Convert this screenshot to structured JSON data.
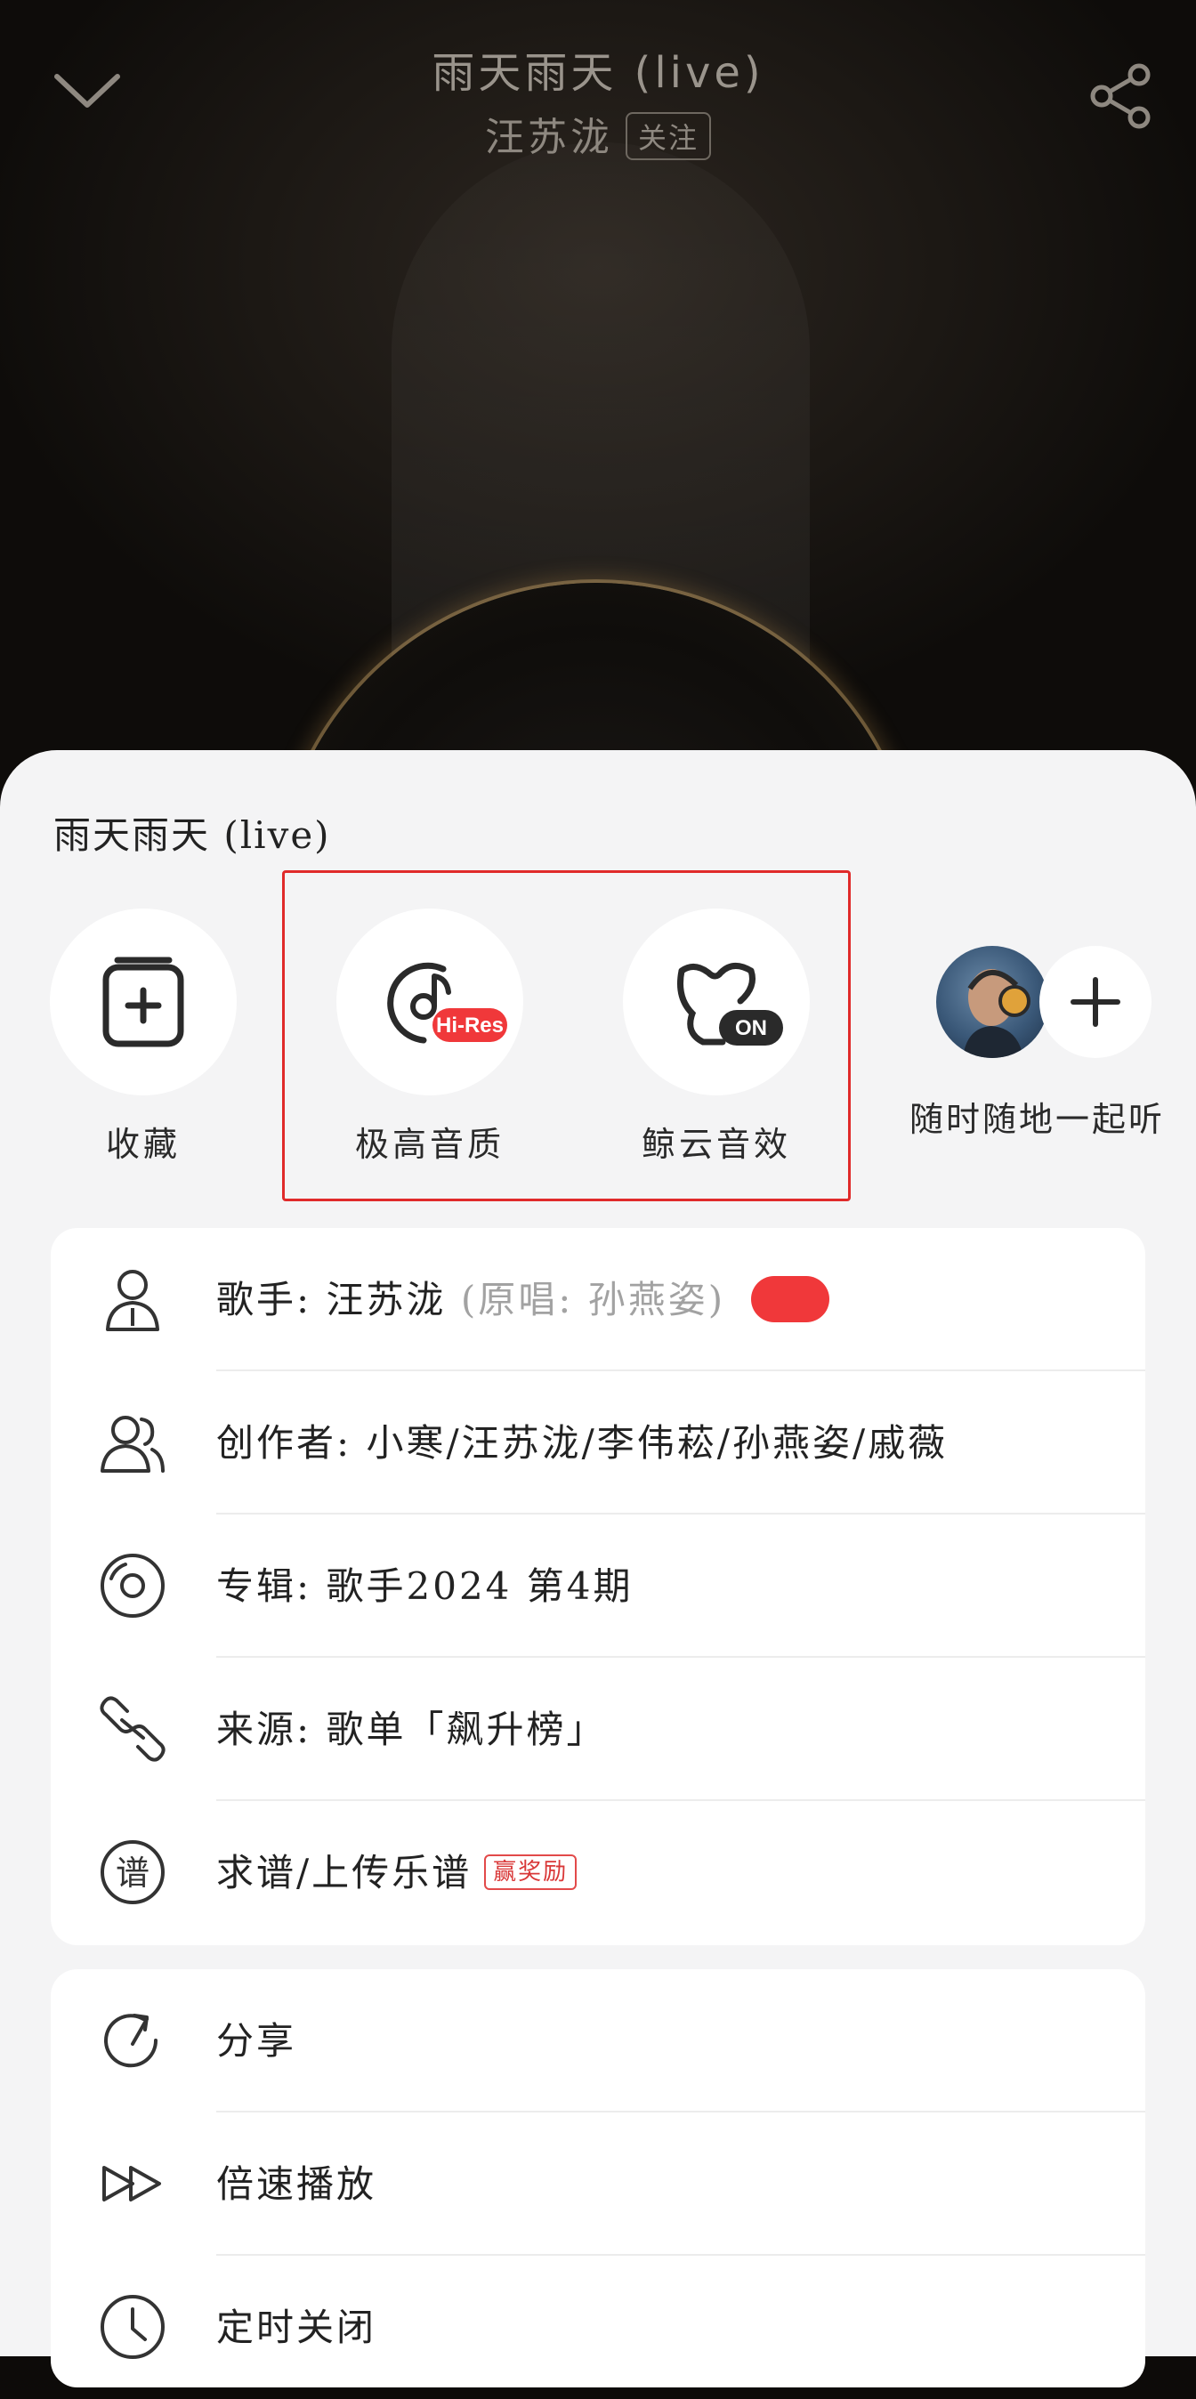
{
  "header": {
    "title": "雨天雨天 (live)",
    "artist": "汪苏泷",
    "follow_label": "关注"
  },
  "sheet": {
    "title": "雨天雨天 (live)",
    "actions": [
      {
        "label": "收藏",
        "icon": "collect-icon"
      },
      {
        "label": "极高音质",
        "icon": "hi-res-icon",
        "badge": "Hi-Res"
      },
      {
        "label": "鲸云音效",
        "icon": "whale-sound-effect-icon",
        "badge": "ON"
      }
    ],
    "listen_together": {
      "label": "随时随地一起听"
    }
  },
  "info_rows": [
    {
      "icon": "singer-icon",
      "label": "歌手: 汪苏泷",
      "extra": "(原唱: 孙燕姿)"
    },
    {
      "icon": "creators-icon",
      "label": "创作者: 小寒/汪苏泷/李伟菘/孙燕姿/戚薇"
    },
    {
      "icon": "album-disc-icon",
      "label": "专辑: 歌手2024 第4期"
    },
    {
      "icon": "link-icon",
      "label": "来源: 歌单「飙升榜」"
    },
    {
      "icon": "score-icon",
      "label": "求谱/上传乐谱",
      "badge": "赢奖励",
      "icon_glyph": "谱"
    }
  ],
  "menu_rows": [
    {
      "icon": "share-arrow-icon",
      "label": "分享"
    },
    {
      "icon": "fast-forward-icon",
      "label": "倍速播放"
    },
    {
      "icon": "clock-icon",
      "label": "定时关闭"
    }
  ],
  "colors": {
    "accent_red": "#f0383a",
    "highlight_box": "#e02a2a",
    "sheet_bg": "#f4f4f5"
  }
}
